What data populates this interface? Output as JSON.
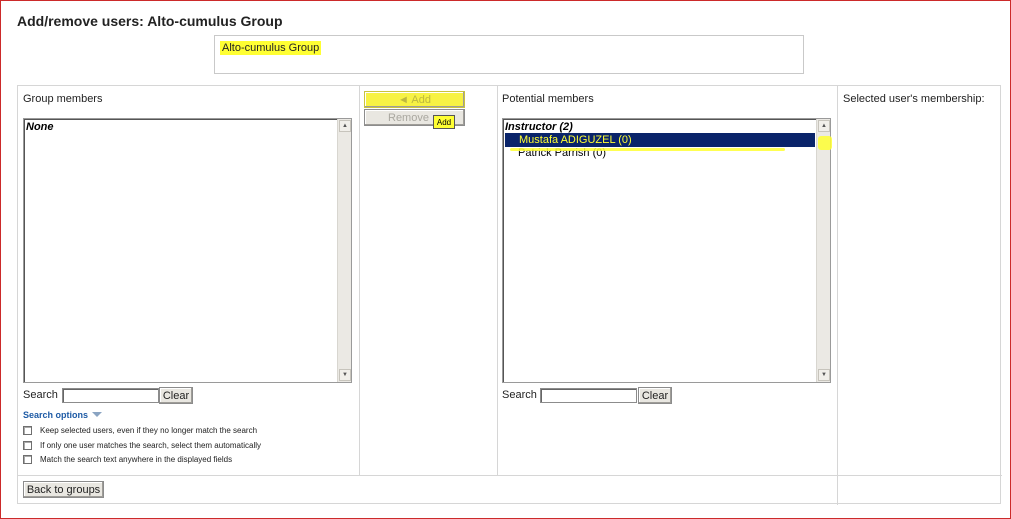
{
  "page": {
    "title": "Add/remove users: Alto-cumulus Group",
    "group_options": [
      "Alto-cumulus Group"
    ]
  },
  "group_members": {
    "heading": "Group members",
    "options": [
      {
        "label": "None",
        "type": "group_label"
      }
    ],
    "search_label": "Search",
    "search_value": "",
    "clear_label": "Clear"
  },
  "actions": {
    "add_label": "◄ Add",
    "remove_label": "Remove",
    "tooltip": "Add"
  },
  "potential_members": {
    "heading": "Potential members",
    "groups": [
      {
        "label": "Instructor (2)",
        "options": [
          {
            "label": "Mustafa ADIGUZEL (0)",
            "selected": true
          },
          {
            "label": "Patrick Parrish (0)",
            "selected": false
          }
        ]
      }
    ],
    "search_label": "Search",
    "search_value": "",
    "clear_label": "Clear"
  },
  "membership": {
    "heading": "Selected user's membership:"
  },
  "search_options": {
    "link_label": "Search options",
    "checkboxes": [
      {
        "label": "Keep selected users, even if they no longer match the search",
        "checked": false
      },
      {
        "label": "If only one user matches the search, select them automatically",
        "checked": false
      },
      {
        "label": "Match the search text anywhere in the displayed fields",
        "checked": false
      }
    ]
  },
  "footer": {
    "back_label": "Back to groups"
  },
  "colors": {
    "highlight": "#ffff33",
    "selected_bg": "#0a246a",
    "link": "#1d5aa5",
    "frame_border": "#cc2a2a"
  }
}
